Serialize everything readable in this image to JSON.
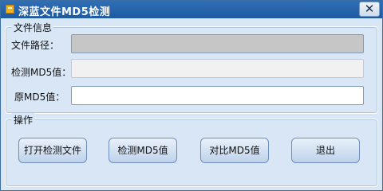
{
  "window": {
    "title": "深蓝文件MD5检测",
    "close_symbol": "✕"
  },
  "file_info": {
    "group_title": "文件信息",
    "file_path_label": "文件路径：",
    "file_path_value": "",
    "detected_md5_label": "检测MD5值：",
    "detected_md5_value": "",
    "original_md5_label": "原MD5值：",
    "original_md5_value": ""
  },
  "operations": {
    "group_title": "操作",
    "open_button": "打开检测文件",
    "detect_button": "检测MD5值",
    "compare_button": "对比MD5值",
    "exit_button": "退出"
  },
  "colors": {
    "titlebar": "#1d5aa1",
    "client_bg": "#d9e6f6",
    "path_field_bg": "#c6c6c6",
    "md5_field_bg": "#f1f1f1",
    "original_field_bg": "#ffffff"
  }
}
